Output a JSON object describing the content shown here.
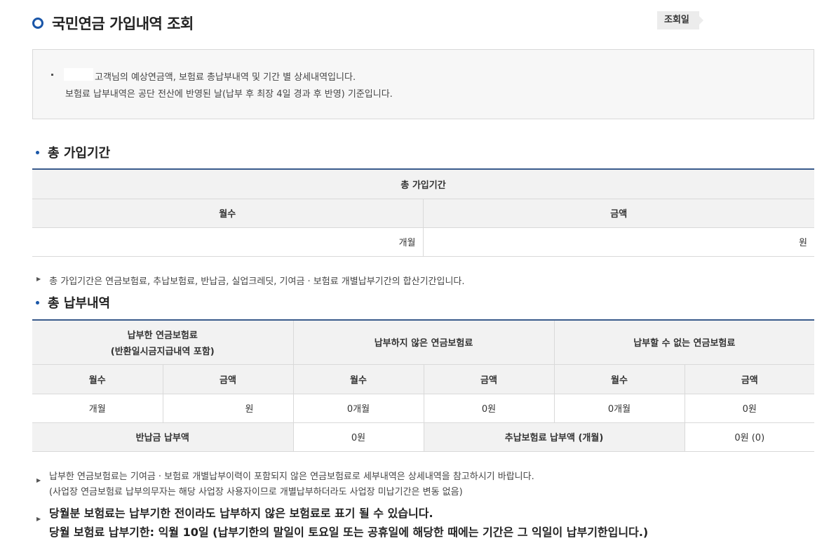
{
  "header": {
    "title": "국민연금 가입내역 조회",
    "date_label": "조회일"
  },
  "notice": {
    "line1": "고객님의 예상연금액, 보험료 총납부내역 및 기간 별 상세내역입니다.",
    "line2": "보험료 납부내역은 공단 전산에 반영된 날(납부 후 최장 4일 경과 후 반영) 기준입니다."
  },
  "total_period": {
    "heading": "총 가입기간",
    "table_title": "총 가입기간",
    "col_months": "월수",
    "col_amount": "금액",
    "months_value": "개월",
    "amount_value": "원"
  },
  "note_period": "총 가입기간은 연금보험료, 추납보험료, 반납금, 실업크레딧, 기여금 · 보험료 개별납부기간의 합산기간입니다.",
  "total_payment": {
    "heading": "총 납부내역",
    "group1_line1": "납부한 연금보험료",
    "group1_line2": "(반환일시금지급내역 포함)",
    "group2": "납부하지 않은 연금보험료",
    "group3": "납부할 수 없는 연금보험료",
    "sub_months": "월수",
    "sub_amount": "금액",
    "row": [
      "개월",
      "원",
      "0개월",
      "0원",
      "0개월",
      "0원"
    ],
    "refund_label": "반납금 납부액",
    "refund_value": "0원",
    "extra_label": "추납보험료 납부액 (개월)",
    "extra_value": "0원 (0)"
  },
  "notes_bottom": {
    "n1": "납부한 연금보험료는 기여금 · 보험료 개별납부이력이 포함되지 않은 연금보험료로 세부내역은 상세내역을 참고하시기 바랍니다.",
    "n2": "(사업장 연금보험료 납부의무자는 해당 사업장 사용자이므로 개별납부하더라도 사업장 미납기간은 변동 없음)",
    "b1": "당월분 보험료는 납부기한 전이라도 납부하지 않은 보험료로 표기 될 수 있습니다.",
    "b2": "당월 보험료 납부기한: 익월 10일 (납부기한의 말일이 토요일 또는 공휴일에 해당한 때에는 기간은 그 익일이 납부기한입니다.)"
  },
  "colors": {
    "accent": "#1a56a8",
    "table_top_border": "#3a5b8c"
  }
}
